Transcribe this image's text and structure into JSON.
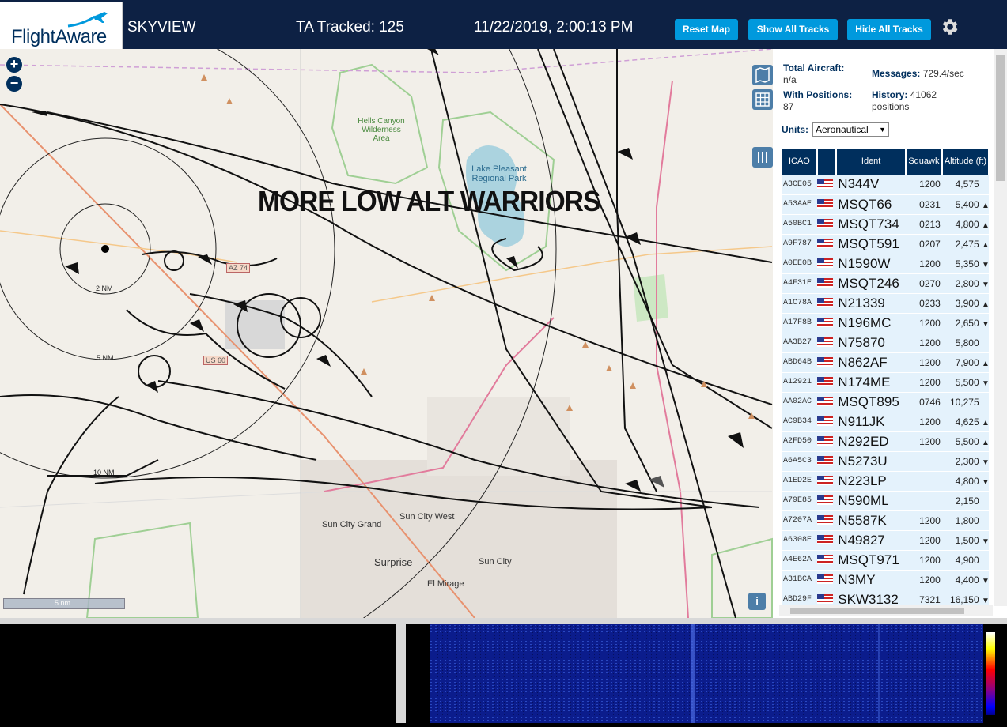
{
  "header": {
    "logo_text": "FlightAware",
    "app_name": "SKYVIEW",
    "tracked": "TA Tracked: 125",
    "datetime": "11/22/2019, 2:00:13 PM",
    "reset_map": "Reset Map",
    "show_all": "Show All Tracks",
    "hide_all": "Hide All Tracks"
  },
  "map": {
    "banner": "MORE LOW ALT WARRIORS",
    "labels": {
      "hells_canyon": "Hells Canyon Wilderness Area",
      "lake_pleasant": "Lake Pleasant Regional Park",
      "sun_city_grand": "Sun City Grand",
      "sun_city_west": "Sun City West",
      "sun_city": "Sun City",
      "surprise": "Surprise",
      "el_mirage": "El Mirage",
      "az74": "AZ 74",
      "us60": "US 60",
      "ring_2": "2 NM",
      "ring_5": "5 NM",
      "ring_10": "10 NM"
    },
    "scale": "5 nm",
    "info": "i",
    "zoom_in": "+",
    "zoom_out": "−"
  },
  "sidebar": {
    "total_aircraft_label": "Total Aircraft:",
    "total_aircraft_value": "n/a",
    "with_positions_label": "With Positions:",
    "with_positions_value": "87",
    "messages_label": "Messages:",
    "messages_value": "729.4/sec",
    "history_label": "History:",
    "history_value": "41062",
    "history_unit": "positions",
    "units_label": "Units:",
    "units_value": "Aeronautical",
    "columns": [
      "ICAO",
      "",
      "Ident",
      "Squawk",
      "Altitude (ft)"
    ],
    "rows": [
      {
        "icao": "A3CE05",
        "ident": "N344V",
        "squawk": "1200",
        "alt": "4,575",
        "trend": ""
      },
      {
        "icao": "A53AAE",
        "ident": "MSQT66",
        "squawk": "0231",
        "alt": "5,400",
        "trend": "▲"
      },
      {
        "icao": "A50BC1",
        "ident": "MSQT734",
        "squawk": "0213",
        "alt": "4,800",
        "trend": "▲"
      },
      {
        "icao": "A9F787",
        "ident": "MSQT591",
        "squawk": "0207",
        "alt": "2,475",
        "trend": "▲"
      },
      {
        "icao": "A0EE0B",
        "ident": "N1590W",
        "squawk": "1200",
        "alt": "5,350",
        "trend": "▼"
      },
      {
        "icao": "A4F31E",
        "ident": "MSQT246",
        "squawk": "0270",
        "alt": "2,800",
        "trend": "▼"
      },
      {
        "icao": "A1C78A",
        "ident": "N21339",
        "squawk": "0233",
        "alt": "3,900",
        "trend": "▲"
      },
      {
        "icao": "A17F8B",
        "ident": "N196MC",
        "squawk": "1200",
        "alt": "2,650",
        "trend": "▼"
      },
      {
        "icao": "AA3B27",
        "ident": "N75870",
        "squawk": "1200",
        "alt": "5,800",
        "trend": ""
      },
      {
        "icao": "ABD64B",
        "ident": "N862AF",
        "squawk": "1200",
        "alt": "7,900",
        "trend": "▲"
      },
      {
        "icao": "A12921",
        "ident": "N174ME",
        "squawk": "1200",
        "alt": "5,500",
        "trend": "▼"
      },
      {
        "icao": "AA02AC",
        "ident": "MSQT895",
        "squawk": "0746",
        "alt": "10,275",
        "trend": ""
      },
      {
        "icao": "AC9B34",
        "ident": "N911JK",
        "squawk": "1200",
        "alt": "4,625",
        "trend": "▲"
      },
      {
        "icao": "A2FD50",
        "ident": "N292ED",
        "squawk": "1200",
        "alt": "5,500",
        "trend": "▲"
      },
      {
        "icao": "A6A5C3",
        "ident": "N5273U",
        "squawk": "",
        "alt": "2,300",
        "trend": "▼"
      },
      {
        "icao": "A1ED2E",
        "ident": "N223LP",
        "squawk": "",
        "alt": "4,800",
        "trend": "▼"
      },
      {
        "icao": "A79E85",
        "ident": "N590ML",
        "squawk": "",
        "alt": "2,150",
        "trend": ""
      },
      {
        "icao": "A7207A",
        "ident": "N5587K",
        "squawk": "1200",
        "alt": "1,800",
        "trend": ""
      },
      {
        "icao": "A6308E",
        "ident": "N49827",
        "squawk": "1200",
        "alt": "1,500",
        "trend": "▼"
      },
      {
        "icao": "A4E62A",
        "ident": "MSQT971",
        "squawk": "1200",
        "alt": "4,900",
        "trend": ""
      },
      {
        "icao": "A31BCA",
        "ident": "N3MY",
        "squawk": "1200",
        "alt": "4,400",
        "trend": "▼"
      },
      {
        "icao": "ABD29F",
        "ident": "SKW3132",
        "squawk": "7321",
        "alt": "16,150",
        "trend": "▼"
      }
    ]
  }
}
